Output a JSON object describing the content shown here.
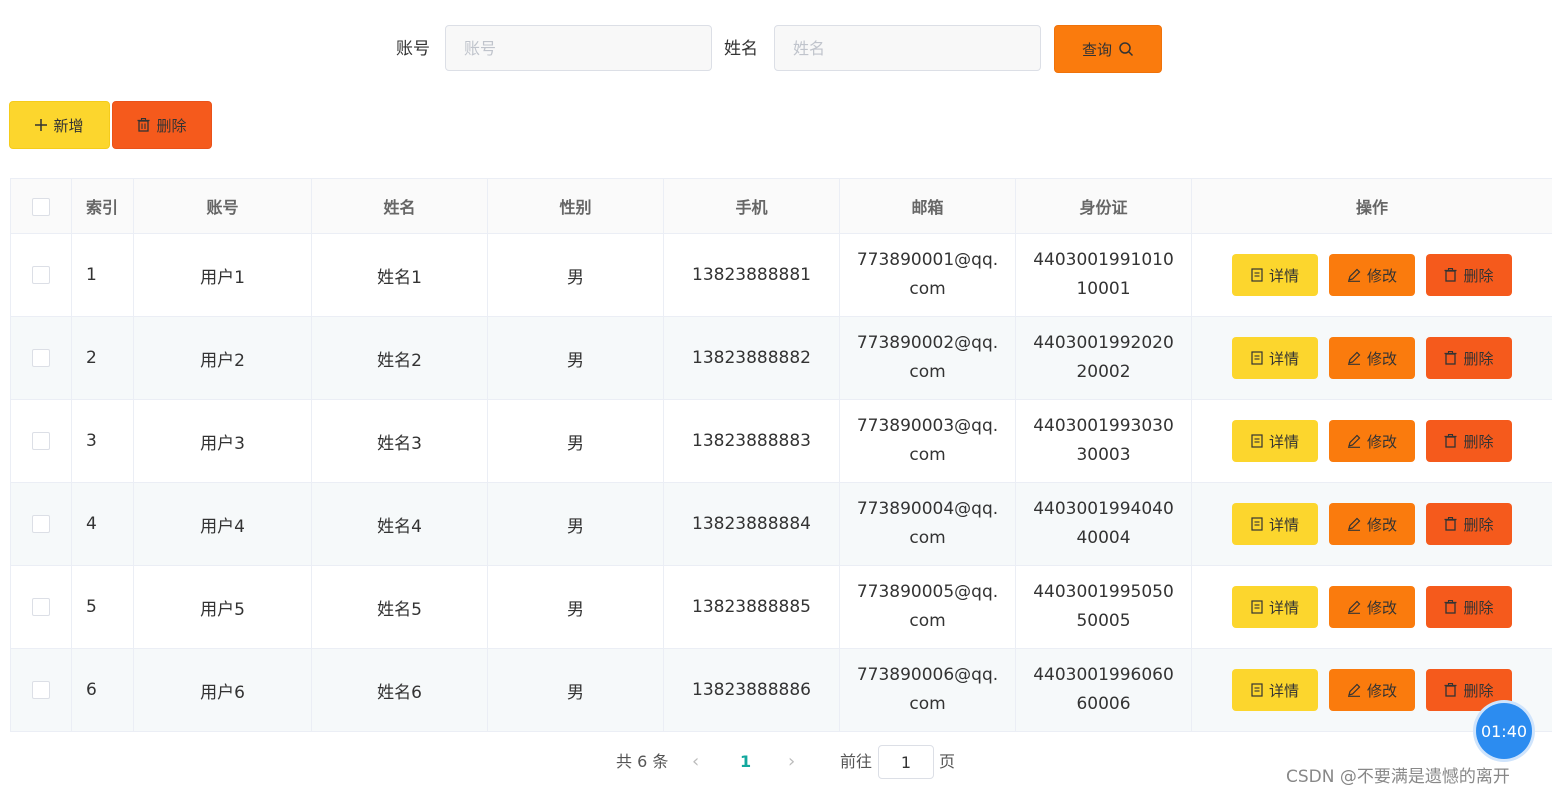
{
  "search": {
    "account_label": "账号",
    "account_placeholder": "账号",
    "name_label": "姓名",
    "name_placeholder": "姓名",
    "query_label": "查询"
  },
  "toolbar": {
    "add_label": "新增",
    "delete_label": "删除"
  },
  "table": {
    "headers": {
      "index": "索引",
      "account": "账号",
      "name": "姓名",
      "gender": "性别",
      "phone": "手机",
      "email": "邮箱",
      "id_card": "身份证",
      "actions": "操作"
    },
    "action_labels": {
      "detail": "详情",
      "edit": "修改",
      "delete": "删除"
    },
    "rows": [
      {
        "index": "1",
        "account": "用户1",
        "name": "姓名1",
        "gender": "男",
        "phone": "13823888881",
        "email": "773890001@qq.com",
        "id_card": "440300199101010001"
      },
      {
        "index": "2",
        "account": "用户2",
        "name": "姓名2",
        "gender": "男",
        "phone": "13823888882",
        "email": "773890002@qq.com",
        "id_card": "440300199202020002"
      },
      {
        "index": "3",
        "account": "用户3",
        "name": "姓名3",
        "gender": "男",
        "phone": "13823888883",
        "email": "773890003@qq.com",
        "id_card": "440300199303030003"
      },
      {
        "index": "4",
        "account": "用户4",
        "name": "姓名4",
        "gender": "男",
        "phone": "13823888884",
        "email": "773890004@qq.com",
        "id_card": "440300199404040004"
      },
      {
        "index": "5",
        "account": "用户5",
        "name": "姓名5",
        "gender": "男",
        "phone": "13823888885",
        "email": "773890005@qq.com",
        "id_card": "440300199505050005"
      },
      {
        "index": "6",
        "account": "用户6",
        "name": "姓名6",
        "gender": "男",
        "phone": "13823888886",
        "email": "773890006@qq.com",
        "id_card": "440300199606060006"
      }
    ]
  },
  "pagination": {
    "total": "共 6 条",
    "current_page": "1",
    "goto_label": "前往",
    "goto_value": "1",
    "page_suffix": "页"
  },
  "overlay": {
    "timer": "01:40",
    "watermark": "CSDN @不要满是遗憾的离开"
  },
  "colors": {
    "yellow": "#fcd62d",
    "orange": "#fa7b0d",
    "red": "#f55a1c",
    "accent_teal": "#13a89e",
    "timer_blue": "#2c8cf0"
  }
}
